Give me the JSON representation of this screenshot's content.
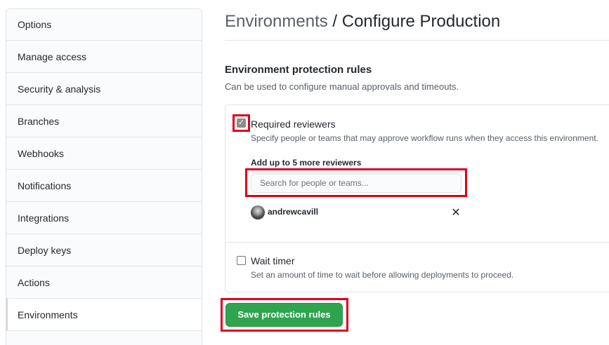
{
  "sidebar": {
    "items": [
      {
        "label": "Options"
      },
      {
        "label": "Manage access"
      },
      {
        "label": "Security & analysis"
      },
      {
        "label": "Branches"
      },
      {
        "label": "Webhooks"
      },
      {
        "label": "Notifications"
      },
      {
        "label": "Integrations"
      },
      {
        "label": "Deploy keys"
      },
      {
        "label": "Actions"
      },
      {
        "label": "Environments",
        "selected": true
      }
    ]
  },
  "header": {
    "crumb_link": "Environments",
    "separator": " / ",
    "title": "Configure Production"
  },
  "protection": {
    "title": "Environment protection rules",
    "description": "Can be used to configure manual approvals and timeouts.",
    "required_reviewers": {
      "checked": true,
      "label": "Required reviewers",
      "note": "Specify people or teams that may approve workflow runs when they access this environment.",
      "add_label": "Add up to 5 more reviewers",
      "search_placeholder": "Search for people or teams...",
      "reviewers": [
        {
          "name": "andrewcavill",
          "icon": "close-icon"
        }
      ]
    },
    "wait_timer": {
      "checked": false,
      "label": "Wait timer",
      "note": "Set an amount of time to wait before allowing deployments to proceed."
    }
  },
  "actions": {
    "save_label": "Save protection rules"
  },
  "colors": {
    "highlight": "#e0001b",
    "primary_button": "#2ea44f",
    "border": "#e1e4e8",
    "muted_text": "#586069"
  }
}
